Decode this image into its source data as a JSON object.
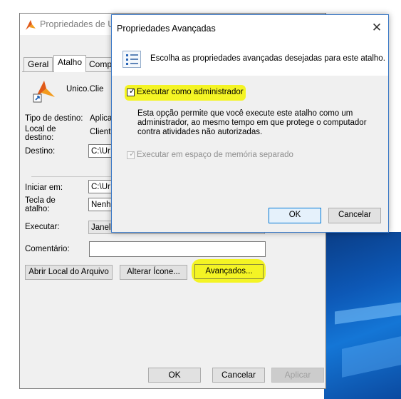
{
  "properties_window": {
    "title": "Propriedades de Un",
    "tabs": [
      "Geral",
      "Atalho",
      "Compa"
    ],
    "shortcut_name": "Unico.Clie",
    "target_type_label": "Tipo de destino:",
    "target_type_value": "Aplica",
    "target_location_label": "Local de destino:",
    "target_location_value": "Client",
    "target_label": "Destino:",
    "target_value": "C:\\Ur",
    "start_in_label": "Iniciar em:",
    "start_in_value": "C:\\Ur",
    "shortcut_key_label": "Tecla de atalho:",
    "shortcut_key_value": "Nenh",
    "run_label": "Executar:",
    "run_value": "Janel",
    "comment_label": "Comentário:",
    "comment_value": "",
    "open_location_button": "Abrir Local do Arquivo",
    "change_icon_button": "Alterar Ícone...",
    "advanced_button": "Avançados...",
    "ok_button": "OK",
    "cancel_button": "Cancelar",
    "apply_button": "Aplicar"
  },
  "advanced_dialog": {
    "title": "Propriedades Avançadas",
    "close_symbol": "✕",
    "intro": "Escolha as propriedades avançadas desejadas para este atalho.",
    "run_as_admin_label": "Executar como administrador",
    "run_as_admin_checked": true,
    "description": "Esta opção permite que você execute este atalho como um administrador, ao mesmo tempo em que protege o computador contra atividades não autorizadas.",
    "separate_memory_label": "Executar em espaço de memória separado",
    "separate_memory_checked": true,
    "separate_memory_enabled": false,
    "ok_button": "OK",
    "cancel_button": "Cancelar"
  },
  "checkmark": "✓",
  "colors": {
    "highlight": "#f4f400",
    "dialog_border": "#3b79c6",
    "default_button_border": "#0078d7"
  }
}
